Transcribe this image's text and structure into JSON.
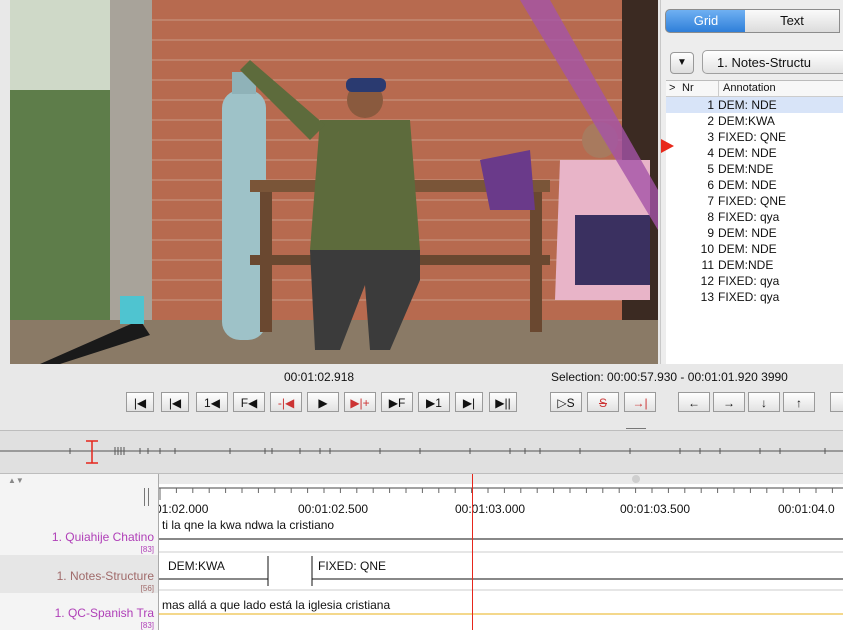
{
  "tabs": {
    "grid": "Grid",
    "text": "Text"
  },
  "tier_select": {
    "value": "1. Notes-Structu"
  },
  "grid": {
    "col_marker": ">",
    "col_nr": "Nr",
    "col_annotation": "Annotation",
    "rows": [
      {
        "nr": "1",
        "ann": "DEM: NDE"
      },
      {
        "nr": "2",
        "ann": "DEM:KWA"
      },
      {
        "nr": "3",
        "ann": "FIXED: QNE"
      },
      {
        "nr": "4",
        "ann": "DEM: NDE"
      },
      {
        "nr": "5",
        "ann": "DEM:NDE"
      },
      {
        "nr": "6",
        "ann": "DEM: NDE"
      },
      {
        "nr": "7",
        "ann": "FIXED: QNE"
      },
      {
        "nr": "8",
        "ann": "FIXED: qya"
      },
      {
        "nr": "9",
        "ann": "DEM: NDE"
      },
      {
        "nr": "10",
        "ann": "DEM: NDE"
      },
      {
        "nr": "11",
        "ann": "DEM:NDE"
      },
      {
        "nr": "12",
        "ann": "FIXED: qya"
      },
      {
        "nr": "13",
        "ann": "FIXED: qya"
      }
    ]
  },
  "media_time": "00:01:02.918",
  "selection": "Selection: 00:00:57.930 - 00:01:01.920  3990",
  "controls": {
    "first": "|◀",
    "prev_frame": "|◀",
    "one_back": "1◀",
    "frame_back": "F◀",
    "sel_back": "-|◀",
    "play": "▶",
    "sel_fwd": "▶|+",
    "frame_fwd": "▶F",
    "one_fwd": "▶1",
    "next": "▶|",
    "last": "▶||",
    "play_sel": "▷S",
    "clear_sel": "S",
    "to_sel": "→|",
    "left": "←",
    "right": "→",
    "down": "↓",
    "up": "↑"
  },
  "ruler": [
    "01:02.000",
    "00:01:02.500",
    "00:01:03.000",
    "00:01:03.500",
    "00:01:04.0"
  ],
  "tiers": [
    {
      "name": "1. Quiahije Chatino",
      "count": "[83]"
    },
    {
      "name": "1. Notes-Structure",
      "count": "[56]"
    },
    {
      "name": "1. QC-Spanish Tra",
      "count": "[83]"
    }
  ],
  "annotations": {
    "chatino": "ti la qne la kwa ndwa la cristiano",
    "notes_1": "DEM:KWA",
    "notes_2": "FIXED: QNE",
    "spanish": "mas allá a que lado está la iglesia cristiana"
  },
  "colors": {
    "accent": "#2f7fd9",
    "cursor": "#e6261c",
    "tier_label": "#b040b8"
  }
}
